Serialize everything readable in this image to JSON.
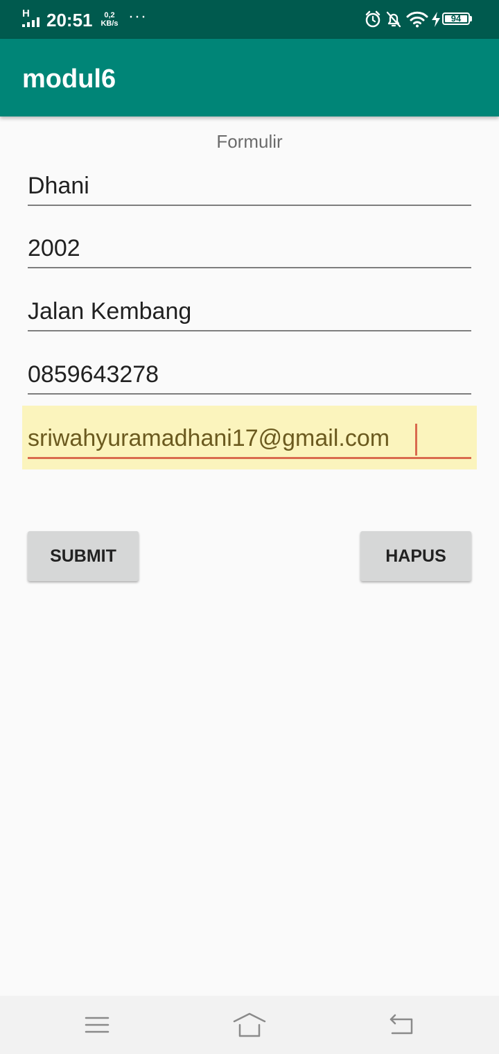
{
  "status_bar": {
    "network_type": "H",
    "time": "20:51",
    "speed_value": "0,2",
    "speed_unit": "KB/s",
    "more": "···",
    "battery_level": "94",
    "icons": [
      "signal-icon",
      "alarm-icon",
      "notifications-off-icon",
      "wifi-icon",
      "charging-icon",
      "battery-icon"
    ]
  },
  "app_bar": {
    "title": "modul6"
  },
  "form": {
    "heading": "Formulir",
    "fields": [
      {
        "value": "Dhani"
      },
      {
        "value": "2002"
      },
      {
        "value": "Jalan Kembang"
      },
      {
        "value": "0859643278"
      },
      {
        "value": "sriwahyuramadhani17@gmail.com"
      }
    ],
    "active_field_index": 4,
    "colors": {
      "underline": "#7d7d7d",
      "active_underline": "#d96a4e",
      "active_highlight": "#fbf4bd"
    }
  },
  "buttons": {
    "submit_label": "SUBMIT",
    "hapus_label": "HAPUS"
  },
  "nav_bar": {
    "icons": [
      "menu-icon",
      "home-icon",
      "back-icon"
    ]
  },
  "colors": {
    "status_bar": "#005a4e",
    "app_bar": "#008577",
    "background": "#fafafa",
    "button": "#d6d7d7"
  }
}
